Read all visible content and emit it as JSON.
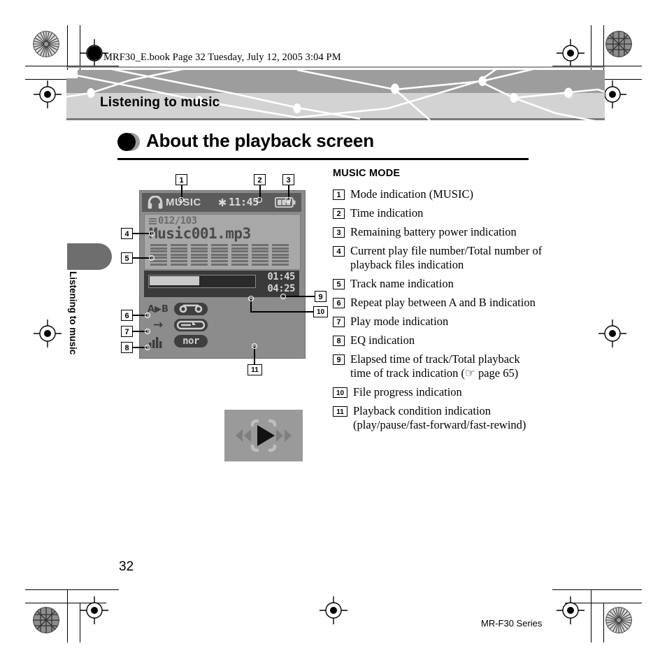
{
  "header": {
    "book_line": "MRF30_E.book  Page 32  Tuesday, July 12, 2005  3:04 PM"
  },
  "banner": {
    "chapter_title": "Listening to music"
  },
  "section": {
    "title": "About the playback screen",
    "bullet_icon": "filled-circle-icon"
  },
  "side_tab": {
    "label": "Listening to music"
  },
  "lcd": {
    "status_bar": {
      "headphone_icon": "headphone-icon",
      "mode_text": "MUSIC",
      "snowflake_icon": "✱",
      "time": "11:45",
      "battery_icon": "battery-icon",
      "battery_segments": 3
    },
    "file_number": "012/103",
    "file_list_icon": "list-lines-icon",
    "track_name": "Music001.mp3",
    "progress": {
      "percent": 47,
      "elapsed_time": "01:45",
      "total_time": "04:25"
    },
    "indicators": [
      {
        "label": "A▶B",
        "icon": "ab-repeat-icon"
      },
      {
        "label": "→",
        "icon": "play-mode-arrow-icon"
      },
      {
        "label": "❘❘❘",
        "icon": "eq-bars-icon",
        "value": "nor"
      }
    ],
    "transport": {
      "rewind_icon": "fast-rewind-icon",
      "play_icon": "play-icon",
      "forward_icon": "fast-forward-icon"
    }
  },
  "legend": {
    "heading": "MUSIC MODE",
    "items": [
      {
        "num": "1",
        "text": "Mode indication (MUSIC)"
      },
      {
        "num": "2",
        "text": "Time indication"
      },
      {
        "num": "3",
        "text": "Remaining battery power indication"
      },
      {
        "num": "4",
        "text": "Current play file number/Total number of playback files indication"
      },
      {
        "num": "5",
        "text": "Track name indication"
      },
      {
        "num": "6",
        "text": "Repeat play between A and B indication"
      },
      {
        "num": "7",
        "text": "Play mode indication"
      },
      {
        "num": "8",
        "text": "EQ indication"
      },
      {
        "num": "9",
        "text": "Elapsed time of track/Total playback time of track indication (☞ page 65)"
      },
      {
        "num": "10",
        "text": "File progress indication"
      },
      {
        "num": "11",
        "text": "Playback condition indication (play/pause/fast-forward/fast-rewind)"
      }
    ]
  },
  "callouts": {
    "c1": "1",
    "c2": "2",
    "c3": "3",
    "c4": "4",
    "c5": "5",
    "c6": "6",
    "c7": "7",
    "c8": "8",
    "c9": "9",
    "c10": "10",
    "c11": "11"
  },
  "footer": {
    "page_number": "32",
    "model": "MR-F30 Series"
  },
  "colors": {
    "banner_top": "#9d9d9d",
    "banner_bottom": "#d3d3d3",
    "side_tab": "#6e6e6e",
    "lcd_body": "#8c8c8c",
    "lcd_statusbar": "#5b5b5b"
  }
}
